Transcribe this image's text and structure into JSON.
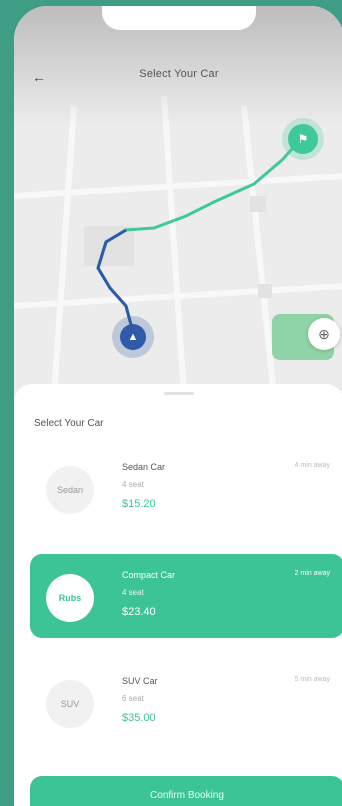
{
  "header": {
    "title": "Select Your Car",
    "back_icon": "arrow-left-icon"
  },
  "map": {
    "destination_icon": "flag-icon",
    "origin_icon": "navigation-arrow-icon",
    "locate_icon": "crosshair-icon"
  },
  "sheet": {
    "title": "Select Your Car",
    "cars": [
      {
        "name": "Sedan Car",
        "meta": "4 seat",
        "price": "$15.20",
        "eta": "4 min away",
        "image": "Sedan",
        "selected": false
      },
      {
        "name": "Compact Car",
        "meta": "4 seat",
        "price": "$23.40",
        "eta": "2 min away",
        "image": "Rubs",
        "selected": true
      },
      {
        "name": "SUV Car",
        "meta": "6 seat",
        "price": "$35.00",
        "eta": "5 min away",
        "image": "SUV",
        "selected": false
      }
    ],
    "confirm_label": "Confirm Booking"
  },
  "colors": {
    "accent": "#3cc497",
    "background": "#3f9c85",
    "route": "#3fc89a",
    "origin": "#2f5aa8"
  }
}
